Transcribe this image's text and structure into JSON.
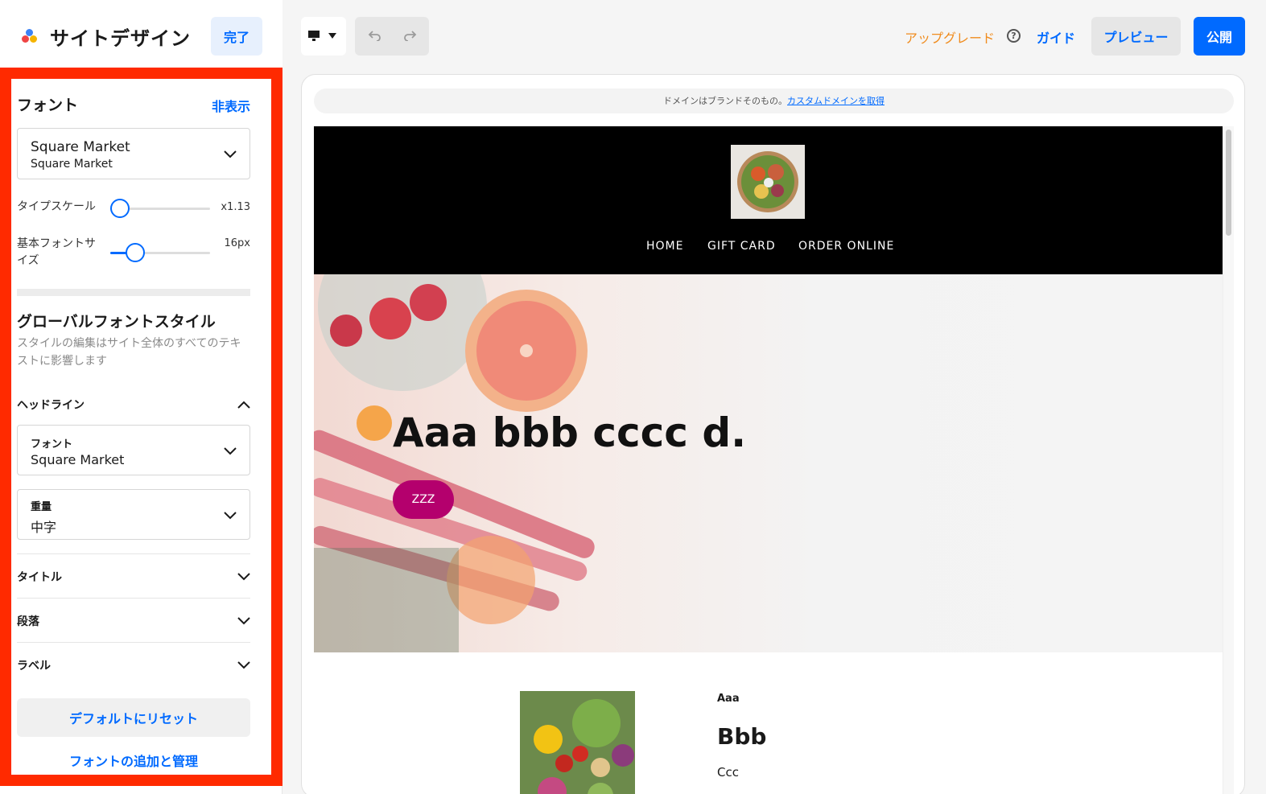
{
  "sidebar": {
    "title": "サイトデザイン",
    "done_label": "完了",
    "fonts": {
      "section_title": "フォント",
      "hide_label": "非表示",
      "font_picker": {
        "name": "Square Market",
        "subname": "Square Market"
      },
      "type_scale": {
        "label": "タイプスケール",
        "value": "x1.13",
        "level": 0.1
      },
      "base_size": {
        "label": "基本フォントサイズ",
        "value": "16px",
        "level": 0.25
      }
    },
    "global": {
      "title": "グローバルフォントスタイル",
      "description": "スタイルの編集はサイト全体のすべてのテキストに影響します",
      "headline_label": "ヘッドライン",
      "font_field": {
        "label": "フォント",
        "value": "Square Market"
      },
      "weight_field": {
        "label": "重量",
        "value": "中字"
      },
      "accordions": [
        "タイトル",
        "段落",
        "ラベル"
      ]
    },
    "reset_label": "デフォルトにリセット",
    "manage_label": "フォントの追加と管理"
  },
  "toolbar": {
    "upgrade_label": "アップグレード",
    "help_glyph": "?",
    "guide_label": "ガイド",
    "preview_label": "プレビュー",
    "publish_label": "公開"
  },
  "canvas": {
    "domain_text": "ドメインはブランドそのもの。",
    "domain_link": "カスタムドメインを取得",
    "nav": [
      "HOME",
      "GIFT CARD",
      "ORDER ONLINE"
    ],
    "hero_heading": "Aaa bbb cccc d.",
    "hero_button": "ZZZ",
    "section_small": "Aaa",
    "section_heading": "Bbb",
    "section_text": "Ccc"
  },
  "colors": {
    "accent": "#006aff",
    "highlight_border": "#ff2a00",
    "upgrade": "#f08c1e",
    "hero_button": "#b4006d"
  }
}
